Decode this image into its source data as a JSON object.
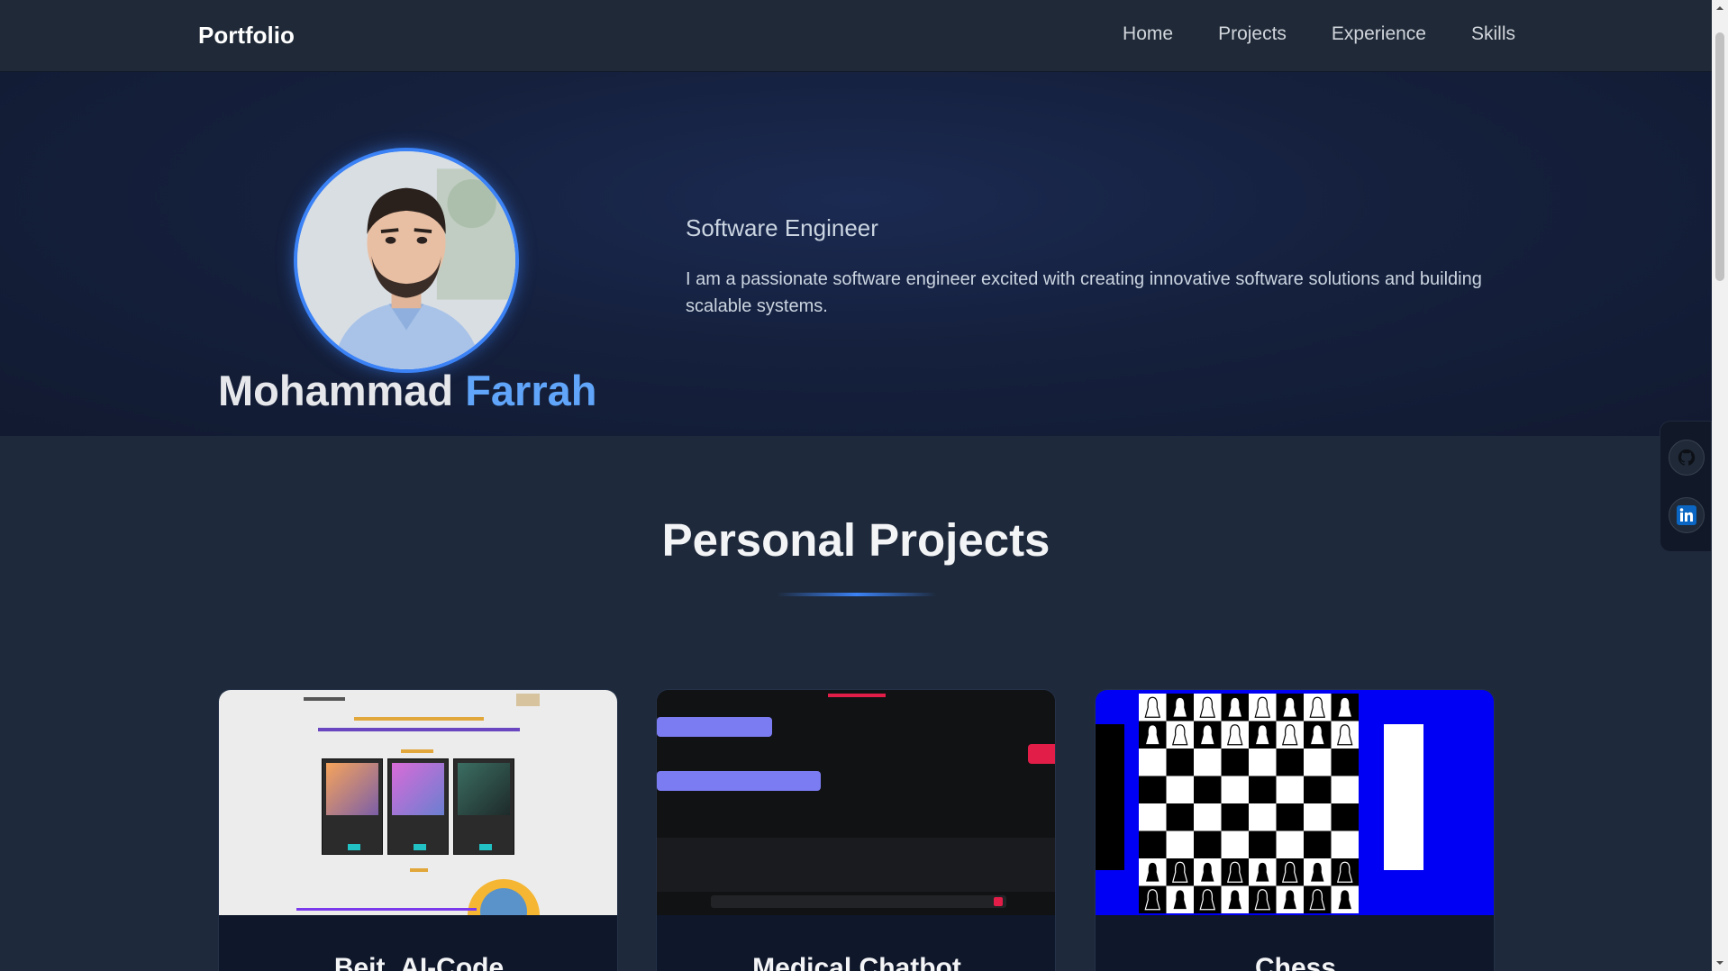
{
  "navbar": {
    "brand": "Portfolio",
    "links": [
      "Home",
      "Projects",
      "Experience",
      "Skills"
    ]
  },
  "hero": {
    "name_first": "Mohammad",
    "name_last": "Farrah",
    "role": "Software Engineer",
    "bio": "I am a passionate software engineer excited with creating innovative software solutions and building scalable systems."
  },
  "social": {
    "items": [
      {
        "name": "github",
        "icon": "github-icon"
      },
      {
        "name": "linkedin",
        "icon": "linkedin-icon"
      }
    ]
  },
  "projects": {
    "title": "Personal Projects",
    "cards": [
      {
        "title": "Beit_AI-Code"
      },
      {
        "title": "Medical Chatbot"
      },
      {
        "title": "Chess"
      }
    ]
  },
  "colors": {
    "accent": "#3b82f6",
    "name_highlight": "#60a5fa",
    "navbar_bg": "#1f2937",
    "page_bg": "#1e293b"
  }
}
